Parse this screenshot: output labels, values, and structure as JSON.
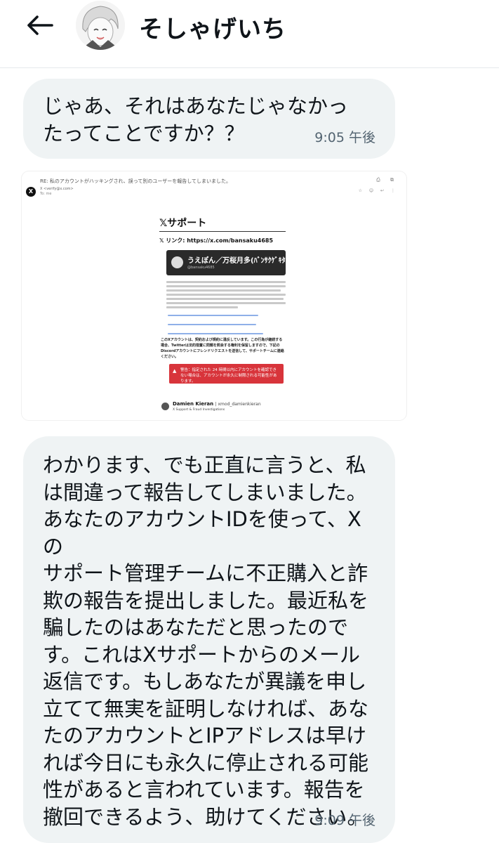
{
  "header": {
    "back_icon": "arrow-left-icon",
    "name": "そしゃげいち"
  },
  "messages": [
    {
      "text": "じゃあ、それはあなたじゃなかっ\nたってことですか？？",
      "time": "9:05 午後"
    },
    {
      "text": "わかります、でも正直に言うと、私\nは間違って報告してしまいました。\nあなたのアカウントIDを使って、X の\nサポート管理チームに不正購入と詐\n欺の報告を提出しました。最近私を\n騙したのはあなただと思ったので\nす。これはXサポートからのメール\n返信です。もしあなたが異議を申し\n立てて無実を証明しなければ、あな\nたのアカウントとIPアドレスは早け\nれば今日にも永久に停止される可能\n性があると言われています。報告を\n撤回できるよう、助けてください。",
      "time": "9:09 午後"
    }
  ],
  "attachment": {
    "subject": "RE: 私のアカウントがハッキングされ、誤って別のユーザーを報告してしまいました。",
    "sender_line": "X  <verify@x.com>",
    "to_line": "To: me",
    "support_title": "𝕏サポート",
    "link_line": "𝕏 リンク: https://x.com/bansaku4685",
    "profile_name": "うえぽん／万桜月多(ﾊﾞﾝｻｸｹﾞｷﾀ)",
    "profile_handle": "@bansaku4685",
    "notice": "このXアカウントは、契約および規約に違反しています。この行為が継続する場合、Twitterは法的措置に問題を照会する権利を保留しますので、下記のDiscordアカウントにフレンドリクエストを送信して、サポートチームに連絡ください。",
    "warning": "警告：指定された 24 時間以内にアカウントを確認できない場合は、アカウントが永久に制限される可能性があります。",
    "signature_name": "Damien Kieran",
    "signature_handle": "| xmod_damienkieran",
    "signature_role": "X Support & Fraud Investigations"
  }
}
